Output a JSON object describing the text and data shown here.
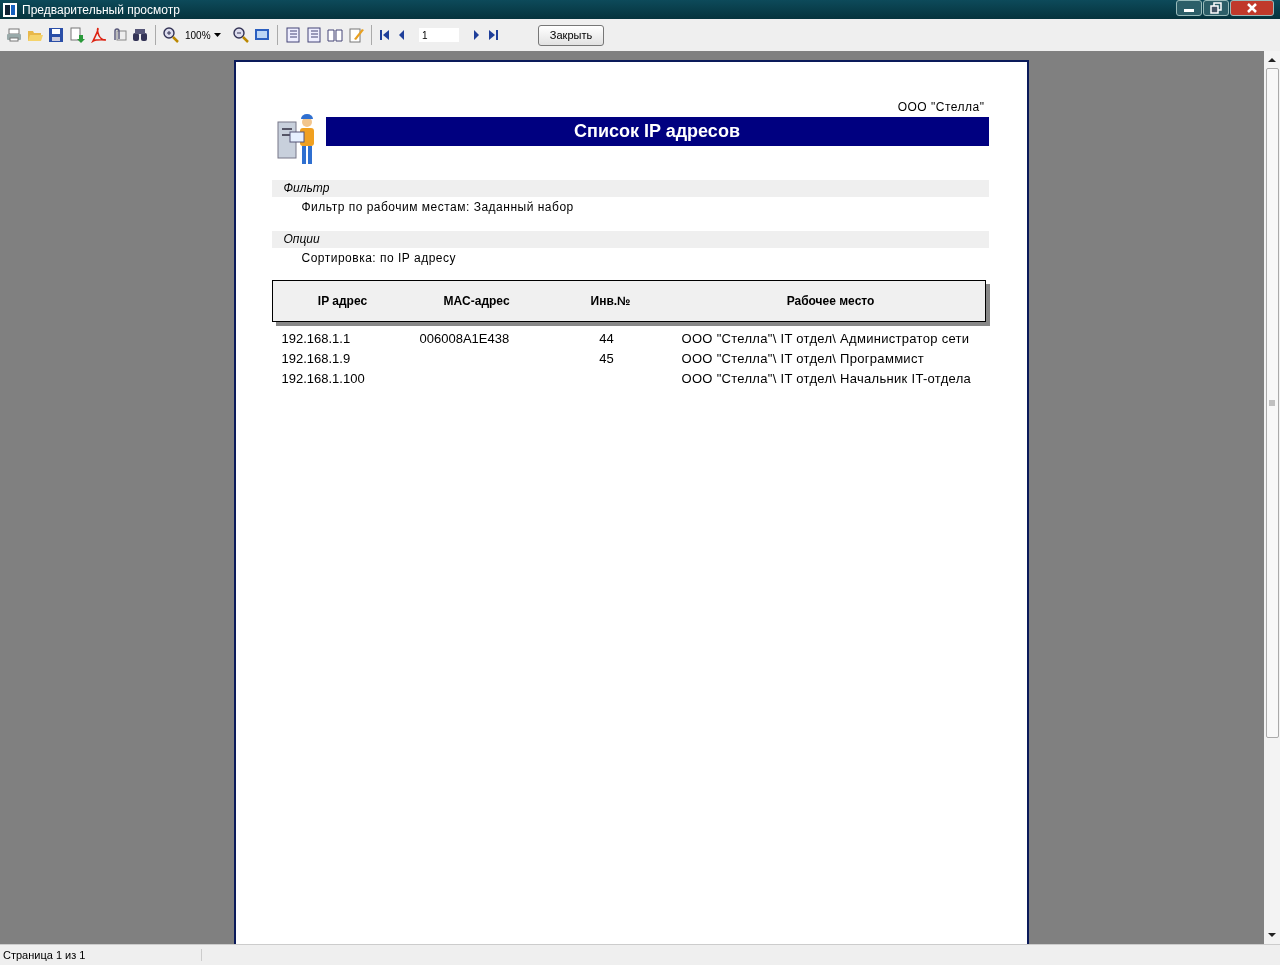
{
  "window": {
    "title": "Предварительный просмотр"
  },
  "toolbar": {
    "zoom": "100%",
    "page": "1",
    "close_button": "Закрыть"
  },
  "report": {
    "company": "ООО \"Стелла\"",
    "title": "Список IP адресов",
    "sections": [
      {
        "heading": "Фильтр",
        "text": "Фильтр по рабочим местам: Заданный набор"
      },
      {
        "heading": "Опции",
        "text": "Сортировка: по IP адресу"
      }
    ],
    "columns": [
      "IP адрес",
      "MAC-адрес",
      "Инв.№",
      "Рабочее место"
    ],
    "rows": [
      [
        "192.168.1.1",
        "006008A1E438",
        "44",
        "ООО \"Стелла\"\\ IT отдел\\ Администратор сети"
      ],
      [
        "192.168.1.9",
        "",
        "45",
        "ООО \"Стелла\"\\ IT отдел\\ Программист"
      ],
      [
        "192.168.1.100",
        "",
        "",
        "ООО \"Стелла\"\\ IT отдел\\ Начальник IT-отдела"
      ]
    ]
  },
  "status_bar": {
    "page_info": "Страница 1 из 1"
  }
}
